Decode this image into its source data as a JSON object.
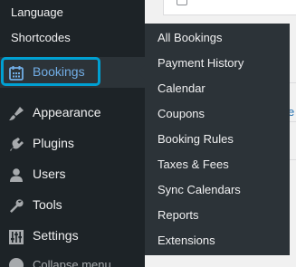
{
  "sidebar": {
    "submenu_items": [
      "Language",
      "Shortcodes"
    ],
    "menu": [
      {
        "label": "Bookings",
        "icon": "calendar-icon",
        "active": true
      },
      {
        "label": "Appearance",
        "icon": "paintbrush-icon"
      },
      {
        "label": "Plugins",
        "icon": "plugin-icon"
      },
      {
        "label": "Users",
        "icon": "users-icon"
      },
      {
        "label": "Tools",
        "icon": "wrench-icon"
      },
      {
        "label": "Settings",
        "icon": "sliders-icon"
      }
    ],
    "collapse_label": "Collapse menu"
  },
  "flyout": {
    "items": [
      "All Bookings",
      "Payment History",
      "Calendar",
      "Coupons",
      "Booking Rules",
      "Taxes & Fees",
      "Sync Calendars",
      "Reports",
      "Extensions"
    ]
  },
  "content": {
    "edge_link": "e"
  },
  "colors": {
    "sidebar_bg": "#1d2327",
    "flyout_bg": "#2c3338",
    "active_text": "#72aee6",
    "highlight": "#00a0d2",
    "text": "#f0f0f1"
  }
}
